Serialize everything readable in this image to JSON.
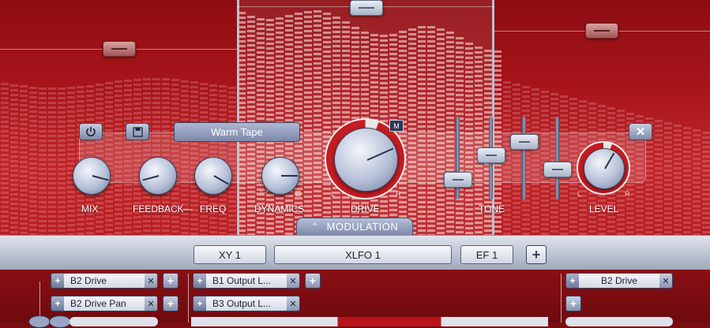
{
  "module": {
    "preset_name": "Warm Tape",
    "knobs": {
      "mix": {
        "label": "MIX",
        "value": 0.85
      },
      "feedback": {
        "label": "FEEDBACK",
        "value": 0.15
      },
      "freq": {
        "label": "FREQ",
        "value": 0.9
      },
      "dynamics": {
        "label": "DYNAMICS",
        "value": 0.8
      },
      "drive": {
        "label": "DRIVE",
        "value": 0.72,
        "l": "L",
        "r": "R",
        "mod_badge": "M"
      },
      "level": {
        "label": "LEVEL",
        "value": 0.6,
        "l": "L",
        "r": "R"
      }
    },
    "tone": {
      "label": "TONE",
      "sliders": [
        0.2,
        0.55,
        0.75,
        0.35
      ]
    },
    "feedback_freq_dash": "—",
    "modulation_tab": "MODULATION",
    "icons": {
      "power": "power-icon",
      "save": "save-icon",
      "close": "close-icon",
      "chevrons": "chevron-up-icon"
    }
  },
  "mod_tabs": [
    {
      "label": "XY 1"
    },
    {
      "label": "XLFO 1"
    },
    {
      "label": "EF 1"
    }
  ],
  "add_tab_label": "+",
  "mod_routes": {
    "xy": [
      {
        "name": "B2 Drive"
      },
      {
        "name": "B2 Drive Pan"
      }
    ],
    "xlfo": [
      {
        "name": "B1 Output L..."
      },
      {
        "name": "B3 Output L..."
      }
    ],
    "ef": [
      {
        "name": "B2 Drive"
      }
    ]
  },
  "colors": {
    "accent_red": "#c51c22",
    "panel_blue": "#8a94b2"
  }
}
